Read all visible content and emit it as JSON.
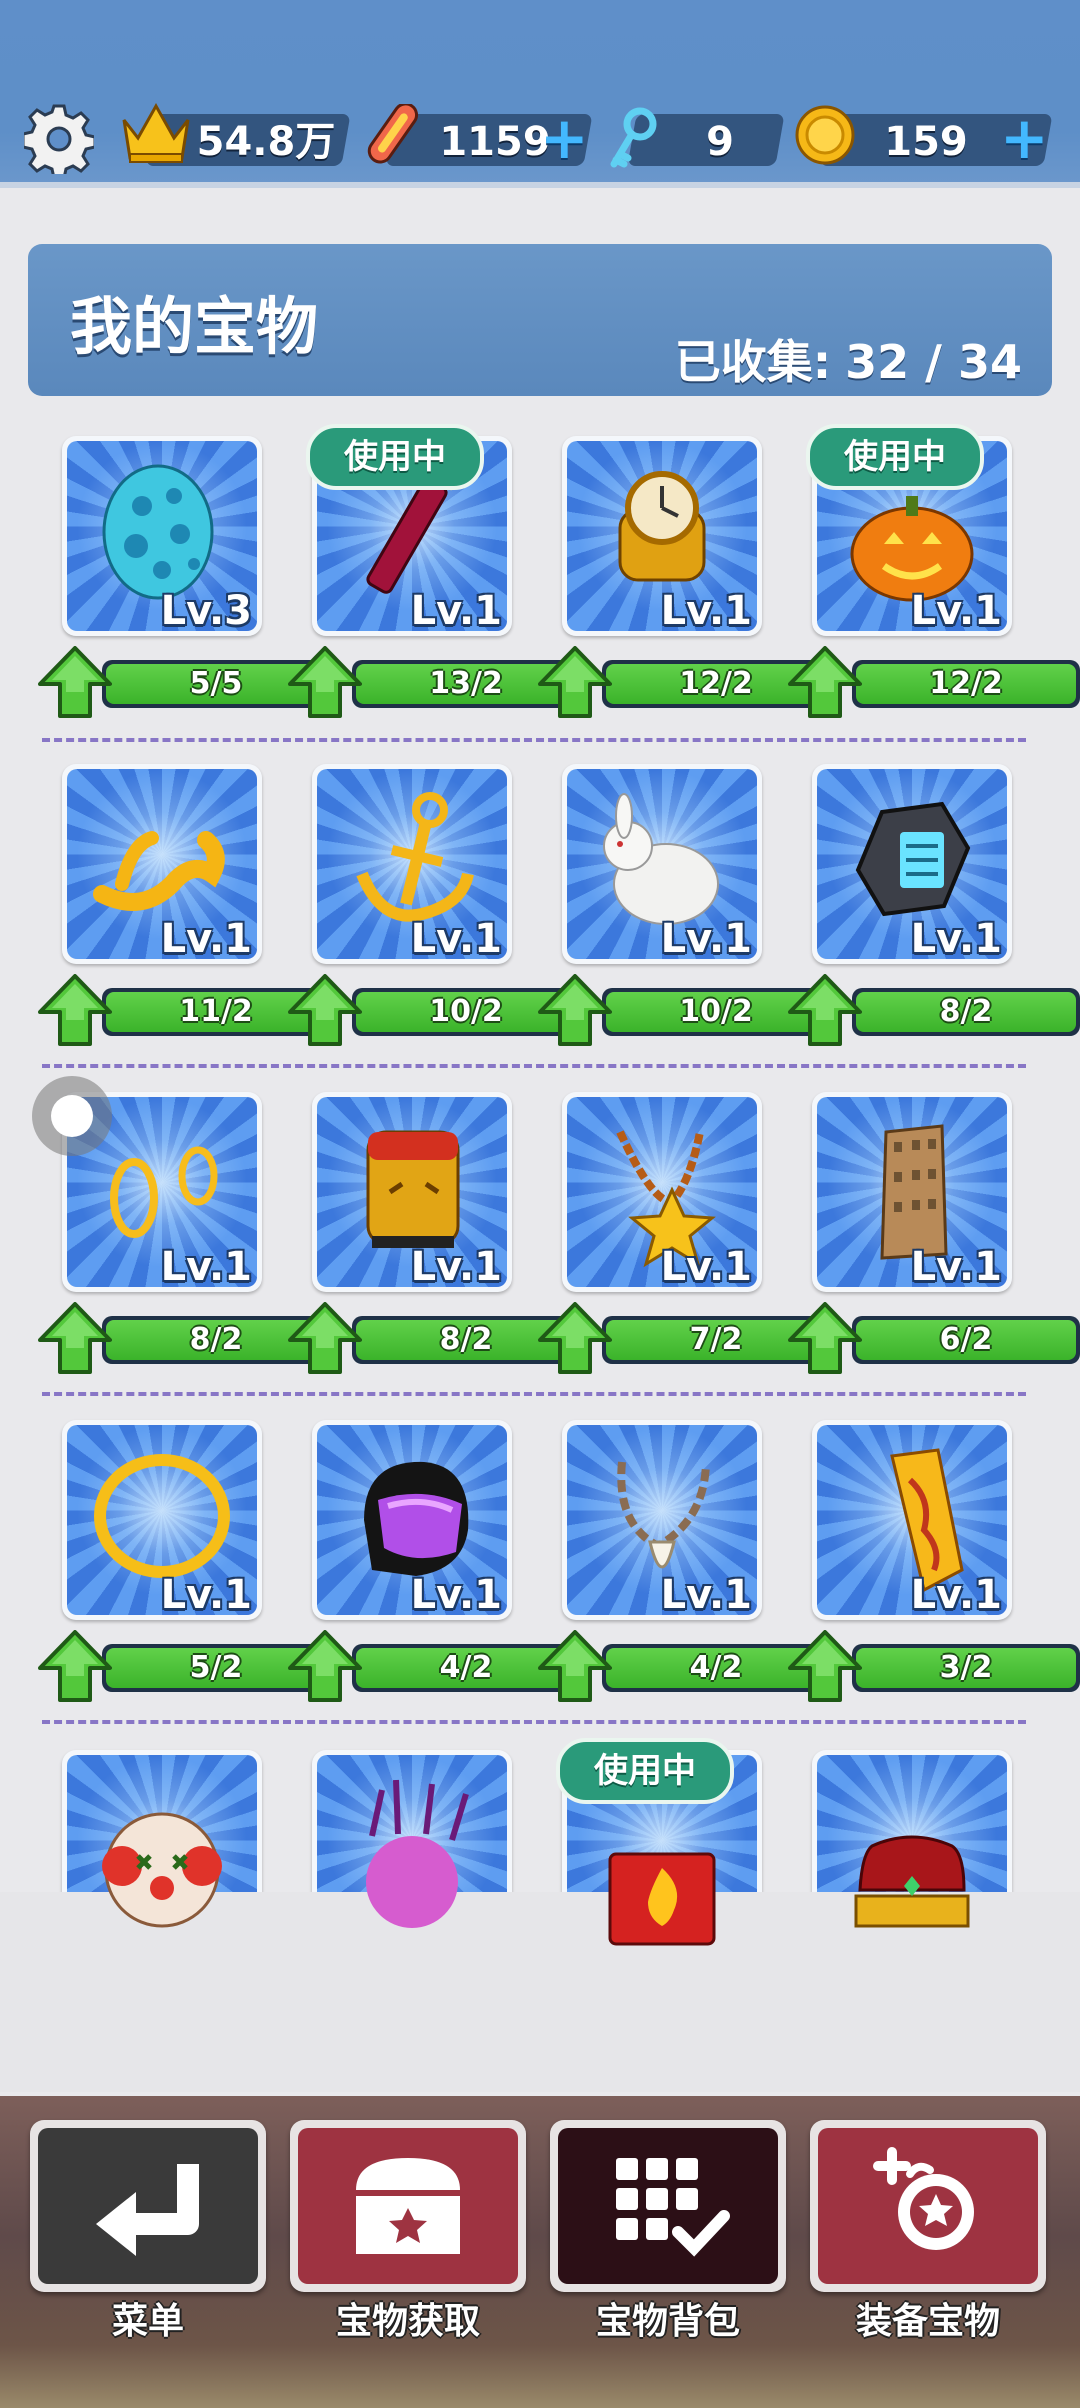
{
  "topbar": {
    "score": "54.8万",
    "boards": "1159",
    "keys": "9",
    "coins": "159"
  },
  "panel": {
    "title": "我的宝物",
    "collected_label": "已收集:",
    "collected_value": "32 / 34"
  },
  "in_use_label": "使用中",
  "treasures": [
    {
      "item": "cyan-egg-icon",
      "level": "Lv.3",
      "progress": "5/5",
      "in_use": false
    },
    {
      "item": "firework-wand-icon",
      "level": "Lv.1",
      "progress": "13/2",
      "in_use": true
    },
    {
      "item": "golden-watch-icon",
      "level": "Lv.1",
      "progress": "12/2",
      "in_use": false
    },
    {
      "item": "pumpkin-icon",
      "level": "Lv.1",
      "progress": "12/2",
      "in_use": true
    },
    {
      "item": "golden-ribbon-icon",
      "level": "Lv.1",
      "progress": "11/2",
      "in_use": false
    },
    {
      "item": "golden-anchor-icon",
      "level": "Lv.1",
      "progress": "10/2",
      "in_use": false
    },
    {
      "item": "white-rabbit-icon",
      "level": "Lv.1",
      "progress": "10/2",
      "in_use": false
    },
    {
      "item": "hex-device-icon",
      "level": "Lv.1",
      "progress": "8/2",
      "in_use": false
    },
    {
      "item": "golden-earrings-icon",
      "level": "Lv.1",
      "progress": "8/2",
      "in_use": false
    },
    {
      "item": "golden-mask-icon",
      "level": "Lv.1",
      "progress": "8/2",
      "in_use": false
    },
    {
      "item": "star-necklace-icon",
      "level": "Lv.1",
      "progress": "7/2",
      "in_use": false
    },
    {
      "item": "tower-building-icon",
      "level": "Lv.1",
      "progress": "6/2",
      "in_use": false
    },
    {
      "item": "golden-halo-icon",
      "level": "Lv.1",
      "progress": "5/2",
      "in_use": false
    },
    {
      "item": "purple-helmet-icon",
      "level": "Lv.1",
      "progress": "4/2",
      "in_use": false
    },
    {
      "item": "tooth-necklace-icon",
      "level": "Lv.1",
      "progress": "4/2",
      "in_use": false
    },
    {
      "item": "golden-guitar-icon",
      "level": "Lv.1",
      "progress": "3/2",
      "in_use": false
    },
    {
      "item": "clown-face-icon",
      "level": "",
      "progress": "",
      "in_use": false
    },
    {
      "item": "purple-crystal-icon",
      "level": "",
      "progress": "",
      "in_use": false
    },
    {
      "item": "fire-box-icon",
      "level": "",
      "progress": "",
      "in_use": true
    },
    {
      "item": "golden-crown-icon",
      "level": "",
      "progress": "",
      "in_use": false
    }
  ],
  "bottom_nav": [
    {
      "label": "菜单",
      "icon": "return-arrow-icon",
      "color": "#3a3a3a"
    },
    {
      "label": "宝物获取",
      "icon": "treasure-chest-icon",
      "color": "#9e3341"
    },
    {
      "label": "宝物背包",
      "icon": "grid-check-icon",
      "color": "#2c0f16"
    },
    {
      "label": "装备宝物",
      "icon": "equip-badge-icon",
      "color": "#9e3341"
    }
  ]
}
